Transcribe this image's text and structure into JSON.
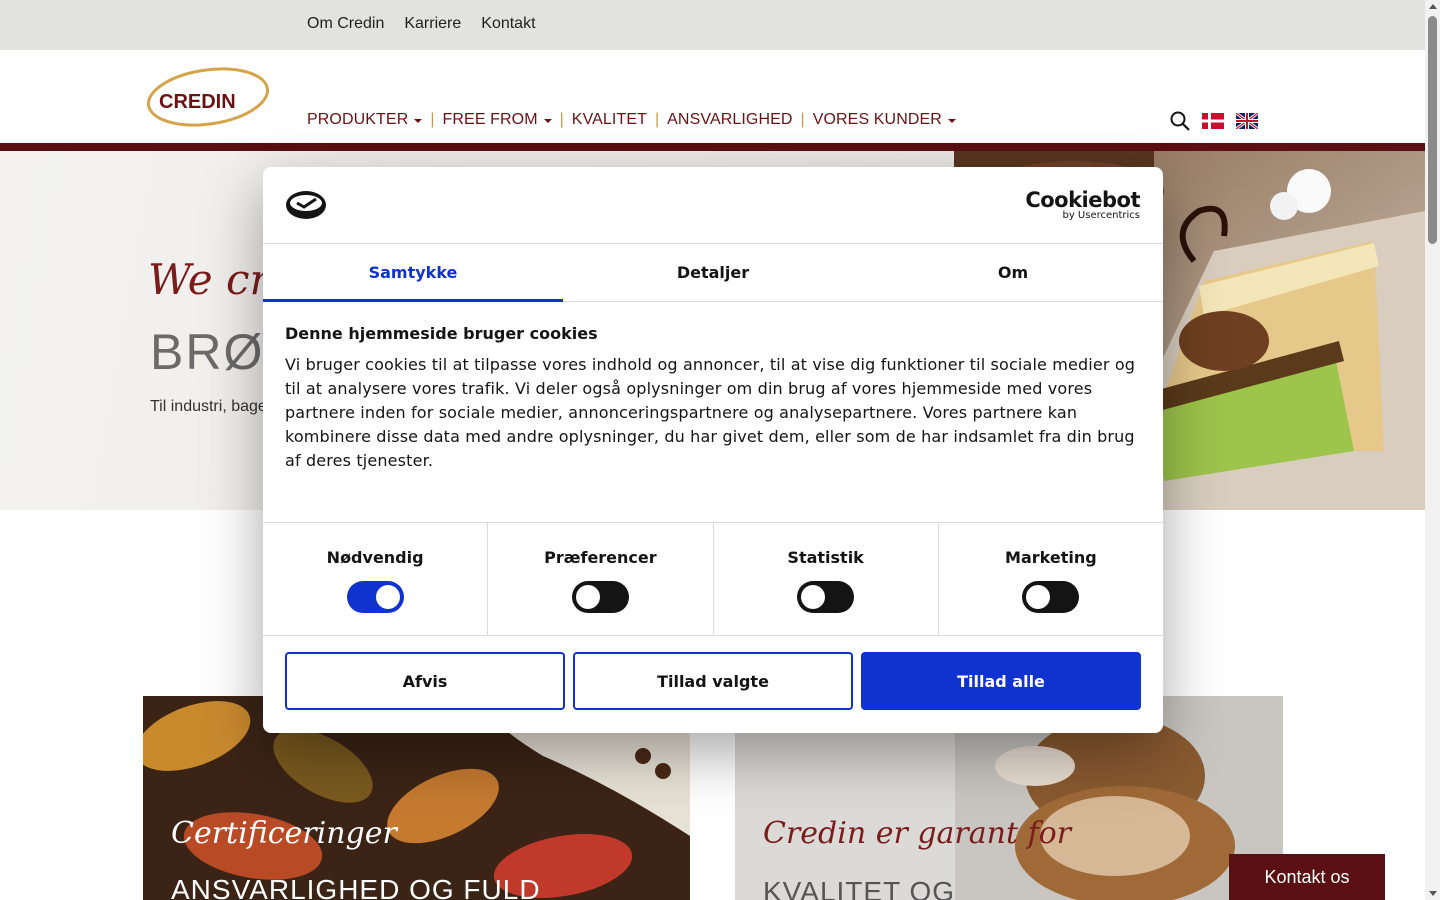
{
  "topbar": {
    "links": [
      "Om Credin",
      "Karriere",
      "Kontakt"
    ]
  },
  "header": {
    "logo_text": "CREDIN",
    "nav": [
      {
        "label": "PRODUKTER",
        "dropdown": true
      },
      {
        "label": "FREE FROM",
        "dropdown": true
      },
      {
        "label": "KVALITET",
        "dropdown": false
      },
      {
        "label": "ANSVARLIGHED",
        "dropdown": false
      },
      {
        "label": "VORES KUNDER",
        "dropdown": true
      }
    ],
    "icons": [
      "search-icon",
      "danish-flag-icon",
      "uk-flag-icon"
    ]
  },
  "hero": {
    "script": "We cre",
    "title": "BRØD",
    "subtitle": "Til industri, bage"
  },
  "cards": [
    {
      "script": "Certificeringer",
      "title": "ANSVARLIGHED OG FULD"
    },
    {
      "script": "Credin er garant for",
      "title": "KVALITET OG"
    }
  ],
  "contact_button": "Kontakt os",
  "cookie_dialog": {
    "brand": "Cookiebot",
    "brand_sub": "by Usercentrics",
    "tabs": [
      {
        "label": "Samtykke",
        "active": true
      },
      {
        "label": "Detaljer",
        "active": false
      },
      {
        "label": "Om",
        "active": false
      }
    ],
    "heading": "Denne hjemmeside bruger cookies",
    "body": "Vi bruger cookies til at tilpasse vores indhold og annoncer, til at vise dig funktioner til sociale medier og til at analysere vores trafik. Vi deler også oplysninger om din brug af vores hjemmeside med vores partnere inden for sociale medier, annonceringspartnere og analysepartnere. Vores partnere kan kombinere disse data med andre oplysninger, du har givet dem, eller som de har indsamlet fra din brug af deres tjenester.",
    "categories": [
      {
        "label": "Nødvendig",
        "enabled": true
      },
      {
        "label": "Præferencer",
        "enabled": false
      },
      {
        "label": "Statistik",
        "enabled": false
      },
      {
        "label": "Marketing",
        "enabled": false
      }
    ],
    "buttons": {
      "deny": "Afvis",
      "allow_selected": "Tillad valgte",
      "allow_all": "Tillad alle"
    }
  },
  "colors": {
    "brand_dark_red": "#5a0f12",
    "nav_red": "#6a1212",
    "cookiebot_blue": "#1032cf",
    "topbar_bg": "#e2e2de"
  }
}
